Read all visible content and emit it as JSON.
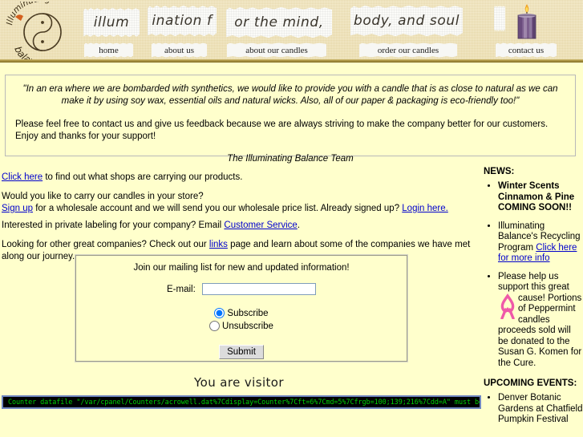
{
  "site": {
    "logo_top_text": "Illuminating",
    "logo_bottom_text": "balance",
    "logo_symbol": "yin-yang-s-symbol"
  },
  "header": {
    "tagline_parts": [
      "illum",
      "ination f",
      "or the mind,",
      "body, and soul"
    ],
    "nav": [
      {
        "label": "home",
        "name": "nav-home"
      },
      {
        "label": "about us",
        "name": "nav-about-us"
      },
      {
        "label": "about our candles",
        "name": "nav-about-our-candles"
      },
      {
        "label": "order our candles",
        "name": "nav-order-our-candles"
      },
      {
        "label": "contact us",
        "name": "nav-contact-us"
      }
    ],
    "candle_icon": "candle-icon",
    "colors": {
      "paper": "#f1e4b8",
      "rule": "#a8913f"
    }
  },
  "quote": {
    "text": "\"In an era where we are bombarded with synthetics, we would like to provide you with a candle that is as close to natural as we can make it by using soy wax, essential oils and natural wicks. Also, all of our paper & packaging is eco-friendly too!\"",
    "paragraph": "Please feel free to contact us and give us feedback because we are always striving to make the company better for our customers. Enjoy and thanks for your support!",
    "signature": "The Illuminating Balance Team"
  },
  "main": {
    "p1_link": "Click here",
    "p1_rest": " to find out what shops are carrying our products.",
    "p2_line1": "Would you like to carry our candles in your store?",
    "p2_link1": "Sign up",
    "p2_mid": " for a wholesale account and we will send you our wholesale price list. Already signed up? ",
    "p2_link2": "Login here.",
    "p3_pre": "Interested in private labeling for your company? Email ",
    "p3_link": "Customer Service",
    "p3_post": ".",
    "p4_pre": "Looking for other great companies? Check out our ",
    "p4_link": "links",
    "p4_post": " page and learn about some of the companies we have met along our journey."
  },
  "form": {
    "title": "Join our mailing list for new and updated information!",
    "email_label": "E-mail:",
    "email_value": "",
    "email_placeholder": "",
    "option_subscribe": "Subscribe",
    "option_unsubscribe": "Unsubscribe",
    "selected_option": "Subscribe",
    "submit_label": "Submit"
  },
  "counter": {
    "heading": "You are visitor",
    "error_text": "Counter datafile \"/var/cpanel/Counters/acrowell.dat%7Cdisplay=Counter%7Cft=6%7Cmd=5%7Cfrgb=100;139;216%7Cdd=A\" must be created in cPanel first!",
    "colors": {
      "text": "#00d000",
      "background": "#000000",
      "border": "#6f86c0"
    }
  },
  "sidebar": {
    "news_heading": "NEWS:",
    "news_items": [
      {
        "text": "Winter Scents Cinnamon & Pine COMING SOON!!",
        "bold": true
      },
      {
        "text": "Illuminating Balance's Recycling Program ",
        "link": "Click here for more info",
        "bold": false
      },
      {
        "pre": "Please help us support this great ",
        "icon": "pink-ribbon-icon",
        "post": "cause! Portions of Peppermint candles proceeds sold will be donated to the Susan G. Komen for the Cure.",
        "bold": false
      }
    ],
    "events_heading": "UPCOMING EVENTS:",
    "events": [
      {
        "text": "Denver Botanic Gardens at Chatfield Pumpkin Festival"
      }
    ]
  }
}
